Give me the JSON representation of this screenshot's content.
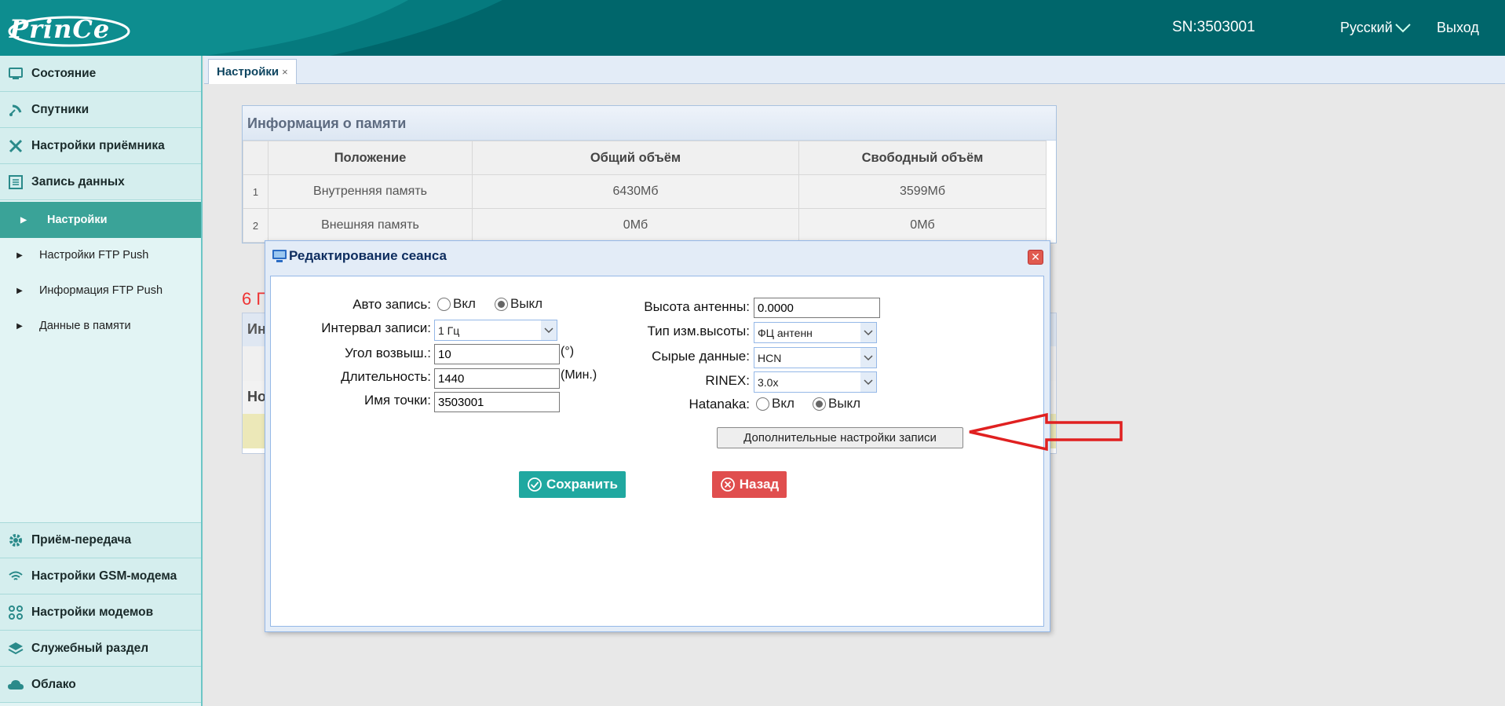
{
  "header": {
    "logo": "PrinCe",
    "serial": "SN:3503001",
    "language": "Русский",
    "logout": "Выход"
  },
  "sidebar": {
    "top_items": [
      {
        "label": "Состояние",
        "icon": "status-icon"
      },
      {
        "label": "Спутники",
        "icon": "satellite-icon"
      },
      {
        "label": "Настройки приёмника",
        "icon": "tools-icon"
      },
      {
        "label": "Запись данных",
        "icon": "list-icon"
      }
    ],
    "sub_items": [
      {
        "label": "Настройки",
        "active": true
      },
      {
        "label": "Настройки FTP Push",
        "active": false
      },
      {
        "label": "Информация FTP Push",
        "active": false
      },
      {
        "label": "Данные в памяти",
        "active": false
      }
    ],
    "bottom_items": [
      {
        "label": "Приём-передача",
        "icon": "gear-icon"
      },
      {
        "label": "Настройки GSM-модема",
        "icon": "wifi-icon"
      },
      {
        "label": "Настройки модемов",
        "icon": "grid-icon"
      },
      {
        "label": "Служебный раздел",
        "icon": "layers-icon"
      },
      {
        "label": "Облако",
        "icon": "cloud-icon"
      }
    ]
  },
  "tabs": [
    {
      "label": "Настройки",
      "close": "×"
    }
  ],
  "memory": {
    "title": "Информация о памяти",
    "columns": [
      "Положение",
      "Общий объём",
      "Свободный объём"
    ],
    "rows": [
      {
        "n": "1",
        "location": "Внутренняя память",
        "total": "6430Мб",
        "free": "3599Мб"
      },
      {
        "n": "2",
        "location": "Внешняя память",
        "total": "0Мб",
        "free": "0Мб"
      }
    ]
  },
  "background": {
    "red_text": "6 П",
    "panel_title": "Ин",
    "row_label": "Но"
  },
  "dialog": {
    "title": "Редактирование сеанса",
    "auto_record": {
      "label": "Авто запись:",
      "on": "Вкл",
      "off": "Выкл",
      "selected": "off"
    },
    "interval": {
      "label": "Интервал записи:",
      "value": "1 Гц"
    },
    "elevation": {
      "label": "Угол возвыш.:",
      "value": "10",
      "unit": "(°)"
    },
    "duration": {
      "label": "Длительность:",
      "value": "1440",
      "unit": "(Мин.)"
    },
    "point_name": {
      "label": "Имя точки:",
      "value": "3503001"
    },
    "antenna_height": {
      "label": "Высота антенны:",
      "value": "0.0000"
    },
    "height_type": {
      "label": "Тип изм.высоты:",
      "value": "ФЦ антенн"
    },
    "raw_data": {
      "label": "Сырые данные:",
      "value": "HCN"
    },
    "rinex": {
      "label": "RINEX:",
      "value": "3.0x"
    },
    "hatanaka": {
      "label": "Hatanaka:",
      "on": "Вкл",
      "off": "Выкл",
      "selected": "off"
    },
    "advanced_button": "Дополнительные настройки записи",
    "save_button": "Сохранить",
    "back_button": "Назад"
  },
  "colors": {
    "header": "#00666b",
    "sidebar_active": "#3aa398",
    "save": "#20a8a0",
    "back": "#e04e4e",
    "arrow": "#e02020"
  }
}
